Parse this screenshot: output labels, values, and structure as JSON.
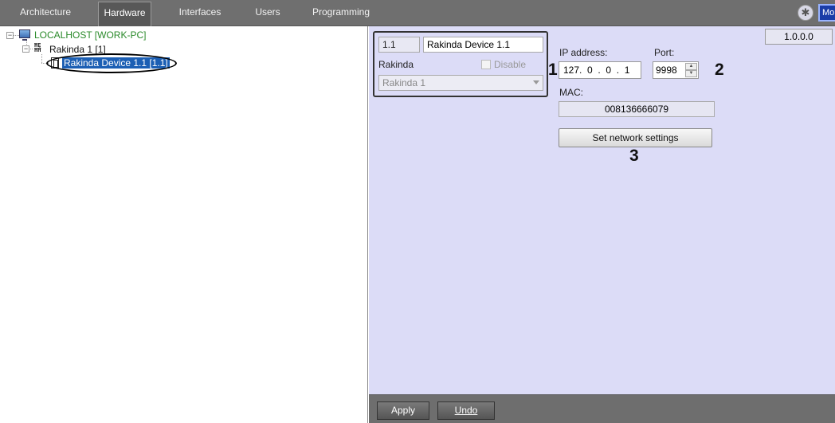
{
  "tabs": [
    {
      "label": "Architecture"
    },
    {
      "label": "Hardware"
    },
    {
      "label": "Interfaces"
    },
    {
      "label": "Users"
    },
    {
      "label": "Programming"
    }
  ],
  "active_tab": "Hardware",
  "mode_button": {
    "label": "Mo"
  },
  "tree": {
    "root": {
      "label": "LOCALHOST [WORK-PC]",
      "icon": "computer-icon"
    },
    "controller": {
      "label": "Rakinda 1 [1]",
      "icon": "controller-icon"
    },
    "device": {
      "label": "Rakinda Device 1.1 [1.1]",
      "icon": "device-icon"
    }
  },
  "settings": {
    "id_value": "1.1",
    "name_value": "Rakinda Device 1.1",
    "type_label": "Rakinda",
    "disable_label": "Disable",
    "disable_checked": false,
    "parent_select": "Rakinda 1",
    "version": "1.0.0.0",
    "ip_label": "IP address:",
    "ip_value": "127.  0  .  0  .  1",
    "port_label": "Port:",
    "port_value": "9998",
    "mac_label": "MAC:",
    "mac_value": "008136666079",
    "set_network_button": "Set network settings",
    "annotations": [
      "1",
      "2",
      "3"
    ]
  },
  "footer": {
    "apply_label": "Apply",
    "undo_label": "Undo"
  },
  "colors": {
    "tab_bar": "#6f6f6f",
    "settings_bg": "#dcdcf7",
    "tree_root_text": "#2a8a2a",
    "selection": "#1c5fb4",
    "mode_button": "#1a3da8"
  }
}
